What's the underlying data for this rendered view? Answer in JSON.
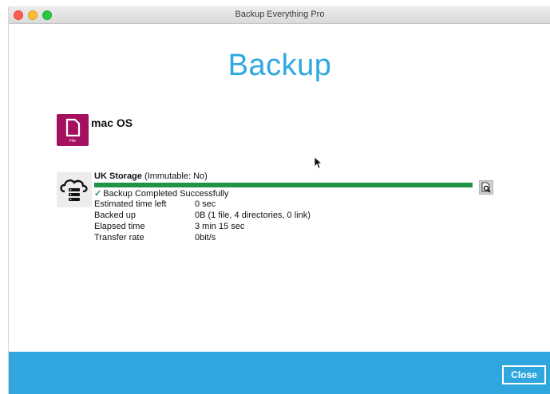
{
  "window": {
    "title": "Backup Everything Pro"
  },
  "page": {
    "heading": "Backup"
  },
  "source": {
    "name": "mac OS",
    "icon": "file-icon",
    "icon_label": "File",
    "icon_color": "#a5105f"
  },
  "destination": {
    "name": "UK Storage",
    "qualifier": "(Immutable: No)",
    "icon": "cloud-storage-icon",
    "progress": 1.0,
    "progress_color": "#1f9447",
    "status": "Backup Completed Successfully",
    "details": [
      {
        "label": "Estimated time left",
        "value": "0 sec"
      },
      {
        "label": "Backed up",
        "value": "0B (1 file, 4 directories, 0 link)"
      },
      {
        "label": "Elapsed time",
        "value": "3 min 15 sec"
      },
      {
        "label": "Transfer rate",
        "value": "0bit/s"
      }
    ]
  },
  "footer": {
    "close_label": "Close",
    "color": "#2fa6dd"
  },
  "accent": "#2ea8e0"
}
